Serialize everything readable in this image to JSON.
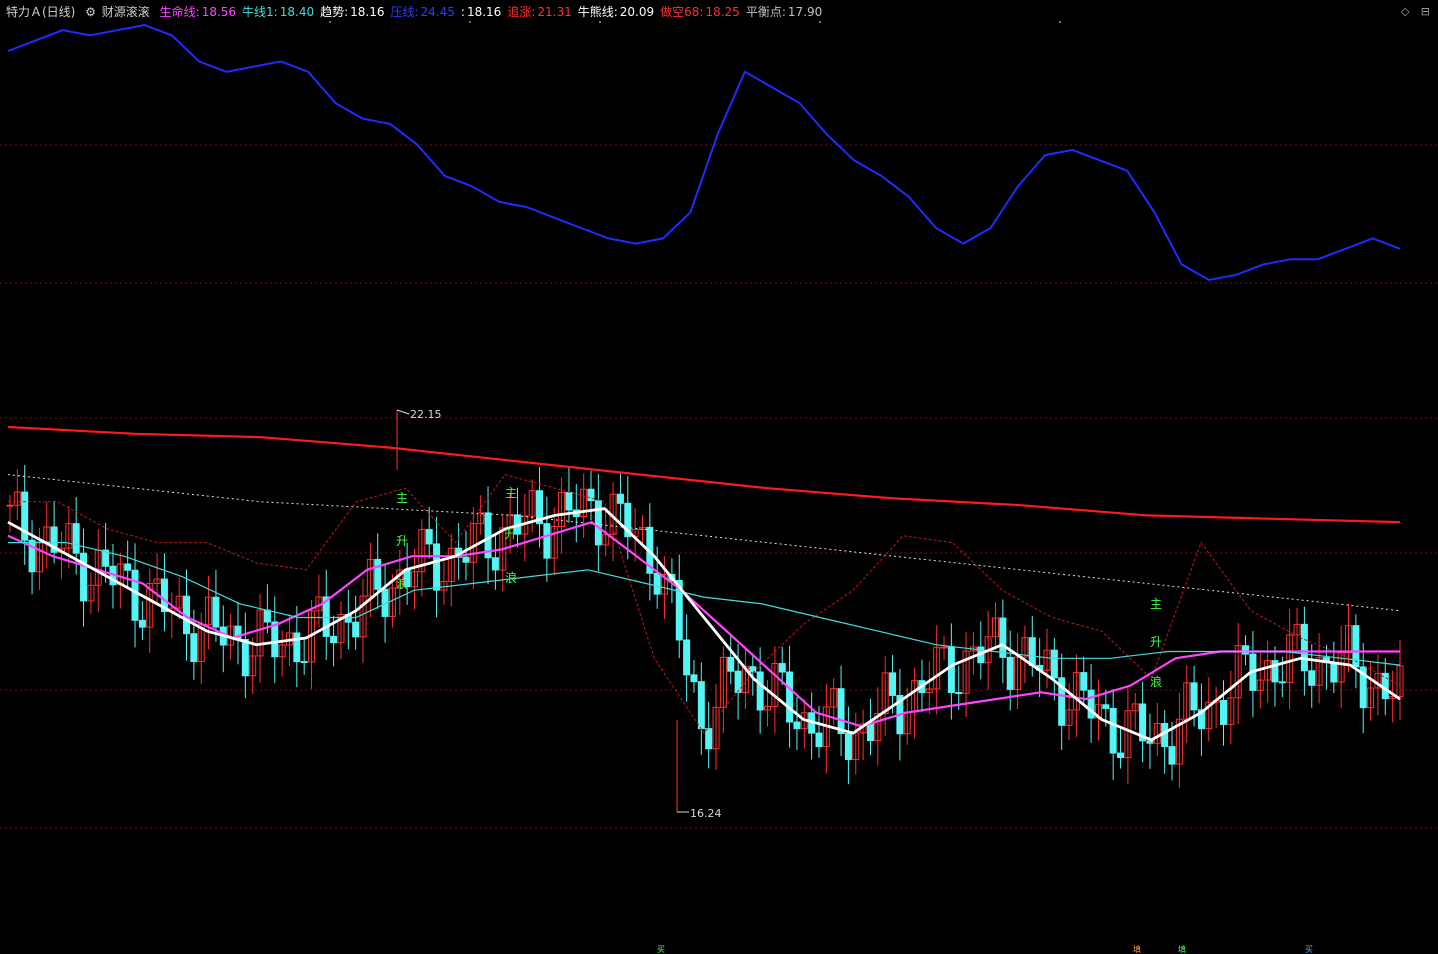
{
  "header": {
    "title": "特力Ａ(日线)",
    "indicator_name": "财源滚滚",
    "indicator_icon": "gear-icon",
    "values": [
      {
        "label": "生命线:",
        "value": "18.56",
        "color": "#ff44ff"
      },
      {
        "label": "牛线1:",
        "value": "18.40",
        "color": "#44dddd"
      },
      {
        "label": "趋势:",
        "value": "18.16",
        "color": "#ffffff"
      },
      {
        "label": "压线:",
        "value": "24.45",
        "color": "#2a3dff"
      },
      {
        "label": ":",
        "value": "18.16",
        "color": "#ffffff"
      },
      {
        "label": "追涨:",
        "value": "21.31",
        "color": "#ff3030"
      },
      {
        "label": "牛熊线:",
        "value": "20.09",
        "color": "#ffffff"
      },
      {
        "label": "做空68:",
        "value": "18.25",
        "color": "#ff3030"
      },
      {
        "label": "平衡点:",
        "value": "17.90",
        "color": "#c0c0c0"
      }
    ]
  },
  "window_icons": [
    "◇",
    "⊟"
  ],
  "chart_data": {
    "type": "line",
    "title": "特力Ａ(日线)",
    "high_label": "22.15",
    "low_label": "16.24",
    "candle_up_color": "#ff3030",
    "candle_down_color": "#54f5f5",
    "annotations": [
      {
        "text": "主",
        "color": "#44ff44"
      },
      {
        "text": "升",
        "color": "#44ff44"
      },
      {
        "text": "浪",
        "color": "#44ff44"
      },
      {
        "text": "主",
        "color": "#44ff44"
      },
      {
        "text": "升",
        "color": "#44ff44"
      },
      {
        "text": "浪",
        "color": "#44ff44"
      },
      {
        "text": "主",
        "color": "#44ff44"
      },
      {
        "text": "升",
        "color": "#44ff44"
      },
      {
        "text": "浪",
        "color": "#44ff44"
      }
    ],
    "series": [
      {
        "name": "压线",
        "color": "#1f2bff",
        "values": [
          24.0,
          24.2,
          24.4,
          24.3,
          24.4,
          24.5,
          24.3,
          23.8,
          23.6,
          23.7,
          23.8,
          23.6,
          23.0,
          22.7,
          22.6,
          22.2,
          21.6,
          21.4,
          21.1,
          21.0,
          20.8,
          20.6,
          20.4,
          20.3,
          20.4,
          20.9,
          22.4,
          23.6,
          23.3,
          23.0,
          22.4,
          21.9,
          21.6,
          21.2,
          20.6,
          20.3,
          20.6,
          21.4,
          22.0,
          22.1,
          21.9,
          21.7,
          20.9,
          19.9,
          19.6,
          19.7,
          19.9,
          20.0,
          20.0,
          20.2,
          20.4,
          20.2
        ]
      },
      {
        "name": "生命线",
        "color": "#ff44ff",
        "values": [
          20.3,
          20.0,
          19.8,
          19.6,
          19.1,
          18.8,
          19.0,
          19.3,
          19.8,
          20.0,
          20.0,
          20.1,
          20.3,
          20.5,
          20.0,
          19.5,
          18.9,
          18.3,
          17.7,
          17.5,
          17.7,
          17.8,
          17.9,
          18.0,
          17.9,
          18.1,
          18.5,
          18.6,
          18.6,
          18.6,
          18.6,
          18.6
        ]
      },
      {
        "name": "牛线1",
        "color": "#44dddd",
        "values": [
          20.2,
          20.2,
          20.0,
          19.7,
          19.3,
          19.1,
          19.1,
          19.5,
          19.6,
          19.7,
          19.8,
          19.6,
          19.4,
          19.3,
          19.1,
          18.9,
          18.7,
          18.6,
          18.5,
          18.5,
          18.6,
          18.6,
          18.6,
          18.5,
          18.4
        ]
      },
      {
        "name": "趋势",
        "color": "#ffffff",
        "values": [
          20.5,
          20.1,
          19.7,
          19.3,
          18.9,
          18.7,
          18.8,
          19.2,
          19.8,
          20.0,
          20.4,
          20.6,
          20.7,
          20.0,
          19.1,
          18.2,
          17.6,
          17.4,
          17.9,
          18.4,
          18.7,
          18.2,
          17.6,
          17.3,
          17.7,
          18.3,
          18.5,
          18.4,
          17.9
        ]
      },
      {
        "name": "牛熊线",
        "color": "#ffffff",
        "values": [
          21.9,
          21.2,
          20.5,
          19.9
        ]
      },
      {
        "name": "做空68",
        "color": "#ff3030",
        "values": [
          22.8,
          22.6,
          22.4,
          22.1,
          21.9,
          21.8,
          21.7,
          21.6,
          21.5,
          21.4,
          21.3
        ]
      }
    ]
  },
  "signals": [
    {
      "text": "买",
      "color": "#44ff44"
    },
    {
      "text": "填",
      "color": "#ff9933"
    },
    {
      "text": "填",
      "color": "#44ff44"
    },
    {
      "text": "买",
      "color": "#44aaff"
    }
  ]
}
